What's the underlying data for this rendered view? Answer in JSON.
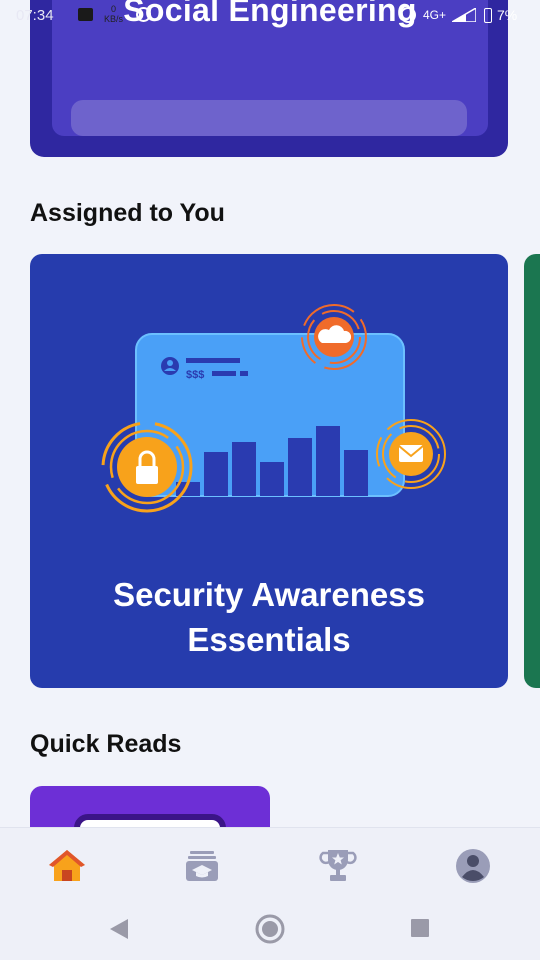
{
  "status_bar": {
    "time": "07:34",
    "net_speed_value": "0",
    "net_speed_unit": "KB/s",
    "network": "4G+",
    "battery": "7%"
  },
  "top_card": {
    "title": "Social Engineering"
  },
  "assigned": {
    "heading": "Assigned to You",
    "card": {
      "title_line1": "Security Awareness",
      "title_line2": "Essentials",
      "illustration_text": "$$$"
    }
  },
  "quick_reads": {
    "heading": "Quick Reads"
  },
  "bottom_nav": {
    "items": [
      {
        "icon": "home-icon",
        "active": true
      },
      {
        "icon": "courses-icon",
        "active": false
      },
      {
        "icon": "trophy-icon",
        "active": false
      },
      {
        "icon": "profile-icon",
        "active": false
      }
    ]
  },
  "system_nav": {
    "items": [
      "back-icon",
      "home-circle-icon",
      "recents-icon"
    ]
  },
  "colors": {
    "top_card": "#2f27a0",
    "course_card": "#263cad",
    "quick_card": "#6d2fd6",
    "next_card": "#1b7650",
    "accent_orange": "#f8a21b"
  }
}
